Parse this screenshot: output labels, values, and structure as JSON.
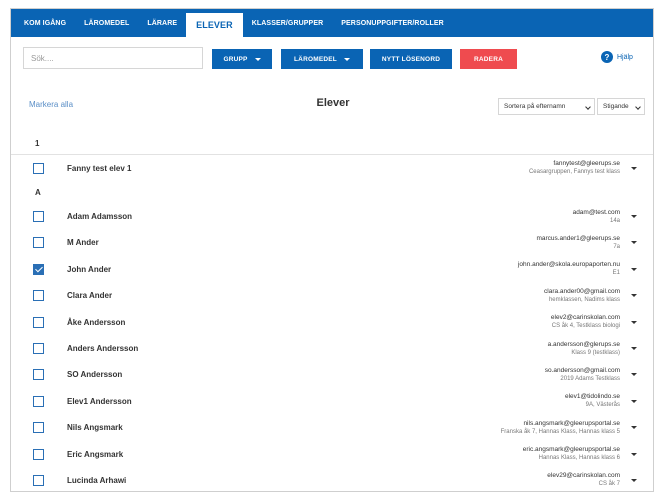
{
  "nav": {
    "tabs": [
      {
        "label": "Kom igång"
      },
      {
        "label": "Läromedel"
      },
      {
        "label": "Lärare"
      },
      {
        "label": "Elever"
      },
      {
        "label": "Klasser/Grupper"
      },
      {
        "label": "Personuppgifter/Roller"
      }
    ],
    "active_tab": "Elever"
  },
  "toolbar": {
    "search_placeholder": "Sök....",
    "grupp_label": "Grupp",
    "laromedel_label": "Läromedel",
    "nytt_losenord_label": "Nytt lösenord",
    "radera_label": "Radera",
    "help_label": "Hjälp"
  },
  "list": {
    "mark_all": "Markera alla",
    "title": "Elever",
    "sort_by": "Sortera på efternamn",
    "sort_order": "Stigande"
  },
  "groups": [
    {
      "letter": "1",
      "students": [
        {
          "name": "Fanny test elev 1",
          "email": "fannytest@gleerups.se",
          "classes": "Ceasargruppen, Fannys test klass",
          "checked": false
        }
      ]
    },
    {
      "letter": "A",
      "students": [
        {
          "name": "Adam Adamsson",
          "email": "adam@test.com",
          "classes": "14a",
          "checked": false
        },
        {
          "name": "M Ander",
          "email": "marcus.ander1@gleerups.se",
          "classes": "7a",
          "checked": false
        },
        {
          "name": "John Ander",
          "email": "john.ander@skola.europaporten.nu",
          "classes": "E1",
          "checked": true
        },
        {
          "name": "Clara Ander",
          "email": "clara.ander00@gmail.com",
          "classes": "hemklassen, Nadims klass",
          "checked": false
        },
        {
          "name": "Åke Andersson",
          "email": "elev2@carinskolan.com",
          "classes": "CS åk 4, Testklass biologi",
          "checked": false
        },
        {
          "name": "Anders Andersson",
          "email": "a.andersson@glerups.se",
          "classes": "Klass 9 (testklass)",
          "checked": false
        },
        {
          "name": "SO Andersson",
          "email": "so.andersson@gmail.com",
          "classes": "2019 Adams Testklass",
          "checked": false
        },
        {
          "name": "Elev1 Andersson",
          "email": "elev1@tidolindo.se",
          "classes": "9A, Västerås",
          "checked": false
        },
        {
          "name": "Nils Angsmark",
          "email": "nils.angsmark@gleerupsportal.se",
          "classes": "Franska åk 7, Hannas Klass, Hannas klass 5",
          "checked": false
        },
        {
          "name": "Eric Angsmark",
          "email": "eric.angsmark@gleerupsportal.se",
          "classes": "Hannas Klass, Hannas klass 6",
          "checked": false
        },
        {
          "name": "Lucinda Arhawi",
          "email": "elev29@carinskolan.com",
          "classes": "CS åk 7",
          "checked": false
        }
      ]
    }
  ],
  "colors": {
    "primary": "#0a64b4",
    "danger": "#ef4b4f",
    "link": "#5b8fc7"
  }
}
